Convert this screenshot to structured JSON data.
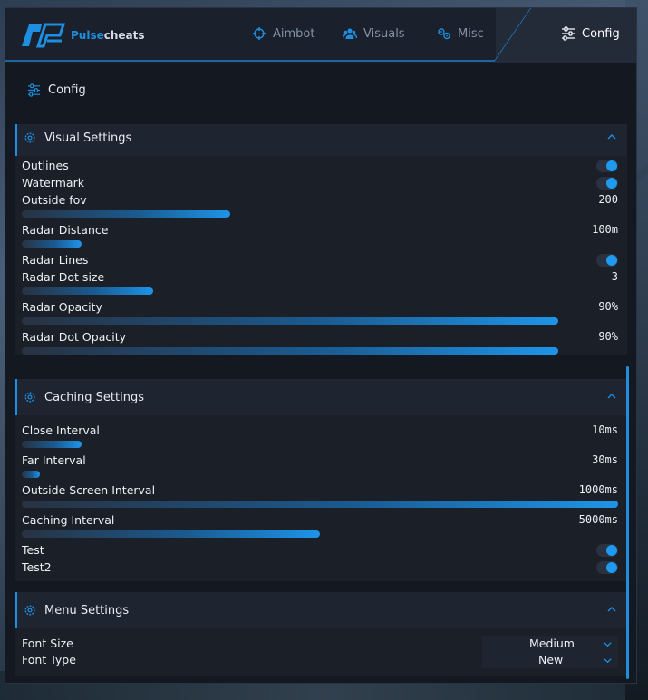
{
  "brand": {
    "name_a": "Pulse",
    "name_b": "cheats"
  },
  "nav": {
    "aimbot": "Aimbot",
    "visuals": "Visuals",
    "misc": "Misc",
    "config": "Config"
  },
  "page_title": "Config",
  "colors": {
    "accent": "#1e8fe0",
    "panel": "#141820",
    "section": "#1a1f28"
  },
  "visual_settings": {
    "title": "Visual Settings",
    "outlines": {
      "label": "Outlines",
      "on": true
    },
    "watermark": {
      "label": "Watermark",
      "on": true
    },
    "outside_fov": {
      "label": "Outside fov",
      "value": "200",
      "level": 0.35
    },
    "radar_distance": {
      "label": "Radar Distance",
      "value": "100m",
      "level": 0.1
    },
    "radar_lines": {
      "label": "Radar Lines",
      "on": true
    },
    "radar_dot_size": {
      "label": "Radar Dot size",
      "value": "3",
      "level": 0.22
    },
    "radar_opacity": {
      "label": "Radar Opacity",
      "value": "90%",
      "level": 0.9
    },
    "radar_dot_opacity": {
      "label": "Radar Dot Opacity",
      "value": "90%",
      "level": 0.9
    }
  },
  "caching_settings": {
    "title": "Caching Settings",
    "close_interval": {
      "label": "Close Interval",
      "value": "10ms",
      "level": 0.1
    },
    "far_interval": {
      "label": "Far Interval",
      "value": "30ms",
      "level": 0.03
    },
    "outside_screen_interval": {
      "label": "Outside Screen Interval",
      "value": "1000ms",
      "level": 1.0
    },
    "caching_interval": {
      "label": "Caching Interval",
      "value": "5000ms",
      "level": 0.5
    },
    "test": {
      "label": "Test",
      "on": true
    },
    "test2": {
      "label": "Test2",
      "on": true
    }
  },
  "menu_settings": {
    "title": "Menu Settings",
    "font_size": {
      "label": "Font Size",
      "value": "Medium"
    },
    "font_type": {
      "label": "Font Type",
      "value": "New"
    }
  }
}
